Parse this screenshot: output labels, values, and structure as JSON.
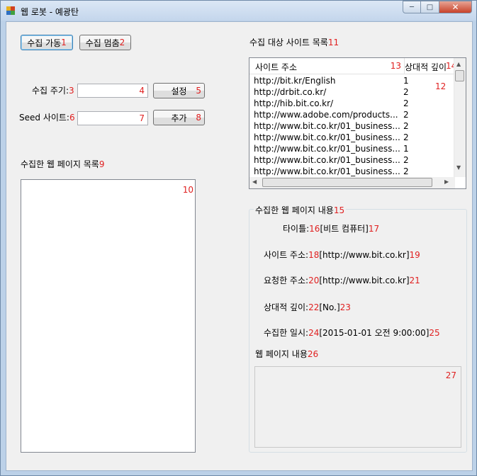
{
  "window": {
    "title": "웹 로봇 - 예광탄",
    "min": "─",
    "max": "□",
    "close": "✕"
  },
  "buttons": {
    "start": "수집 가동",
    "start_no": "1",
    "stop": "수집 멈춤",
    "stop_no": "2",
    "set": "설정",
    "set_no": "5",
    "add": "추가",
    "add_no": "8"
  },
  "period": {
    "label": "수집 주기:",
    "label_no": "3",
    "value": "",
    "input_no": "4"
  },
  "seed": {
    "label": "Seed 사이트:",
    "label_no": "6",
    "value": "",
    "input_no": "7"
  },
  "collected_list": {
    "label": "수집한 웹 페이지 목록",
    "label_no": "9",
    "box_no": "10"
  },
  "targets": {
    "label": "수집 대상 사이트 목록",
    "label_no": "11",
    "list_no": "12",
    "col_address": "사이트 주소",
    "col_address_no": "13",
    "col_depth": "상대적 깊이",
    "col_depth_no": "14",
    "rows": [
      {
        "url": "http://bit.kr/English",
        "depth": "1"
      },
      {
        "url": "http://drbit.co.kr/",
        "depth": "2"
      },
      {
        "url": "http://hib.bit.co.kr/",
        "depth": "2"
      },
      {
        "url": "http://www.adobe.com/products...",
        "depth": "2"
      },
      {
        "url": "http://www.bit.co.kr/01_business...",
        "depth": "2"
      },
      {
        "url": "http://www.bit.co.kr/01_business...",
        "depth": "2"
      },
      {
        "url": "http://www.bit.co.kr/01_business...",
        "depth": "1"
      },
      {
        "url": "http://www.bit.co.kr/01_business...",
        "depth": "2"
      },
      {
        "url": "http://www.bit.co.kr/01_business...",
        "depth": "2"
      }
    ]
  },
  "page_content": {
    "group": "수집한 웹 페이지 내용",
    "group_no": "15",
    "title_label": "타이틀:",
    "title_label_no": "16",
    "title_value": "[비트 컴퓨터]",
    "title_value_no": "17",
    "site_label": "사이트 주소:",
    "site_label_no": "18",
    "site_value": "[http://www.bit.co.kr]",
    "site_value_no": "19",
    "req_label": "요청한 주소:",
    "req_label_no": "20",
    "req_value": "[http://www.bit.co.kr]",
    "req_value_no": "21",
    "depth_label": "상대적 깊이:",
    "depth_label_no": "22",
    "depth_value": "[No.]",
    "depth_value_no": "23",
    "date_label": "수집한 일시:",
    "date_label_no": "24",
    "date_value": "[2015-01-01 오전 9:00:00]",
    "date_value_no": "25",
    "body_label": "웹 페이지 내용",
    "body_label_no": "26",
    "body_no": "27"
  }
}
